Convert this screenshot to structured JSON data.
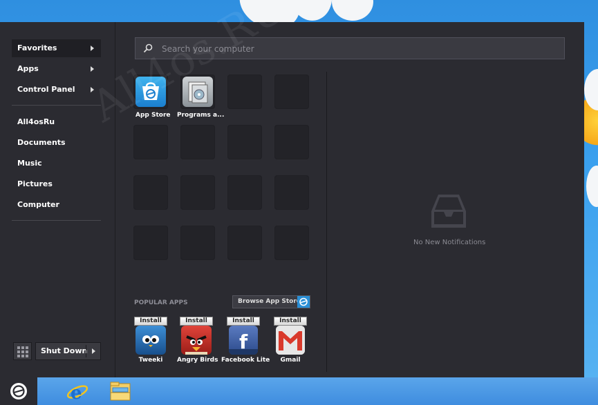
{
  "sidebar": {
    "items": [
      {
        "label": "Favorites",
        "arrow": true,
        "active": true
      },
      {
        "label": "Apps",
        "arrow": true
      },
      {
        "label": "Control Panel",
        "arrow": true
      },
      {
        "label": "All4osRu"
      },
      {
        "label": "Documents"
      },
      {
        "label": "Music"
      },
      {
        "label": "Pictures"
      },
      {
        "label": "Computer"
      }
    ],
    "shutdown_label": "Shut Down"
  },
  "search": {
    "placeholder": "Search your computer"
  },
  "favorites": [
    {
      "label": "App Store",
      "icon": "app-store-icon"
    },
    {
      "label": "Programs a...",
      "icon": "programs-icon"
    }
  ],
  "popular": {
    "heading": "POPULAR APPS",
    "browse_label": "Browse App Store",
    "install_label": "Install",
    "apps": [
      {
        "label": "Tweeki",
        "icon": "tweeki-icon",
        "color": "#1f6fb5"
      },
      {
        "label": "Angry Birds",
        "icon": "angry-birds-icon",
        "color": "#c8302a"
      },
      {
        "label": "Facebook Lite",
        "icon": "facebook-icon",
        "color": "#3b5998"
      },
      {
        "label": "Gmail",
        "icon": "gmail-icon",
        "color": "#d93a2c"
      }
    ]
  },
  "notifications": {
    "empty_text": "No New Notifications"
  },
  "watermark": "All4os.RU",
  "taskbar": {
    "items": [
      "start-orb-icon",
      "internet-explorer-icon",
      "file-explorer-icon"
    ]
  },
  "colors": {
    "menu_bg": "#2b2b31",
    "accent": "#2a8fd6",
    "taskbar": "#4a98e4"
  }
}
